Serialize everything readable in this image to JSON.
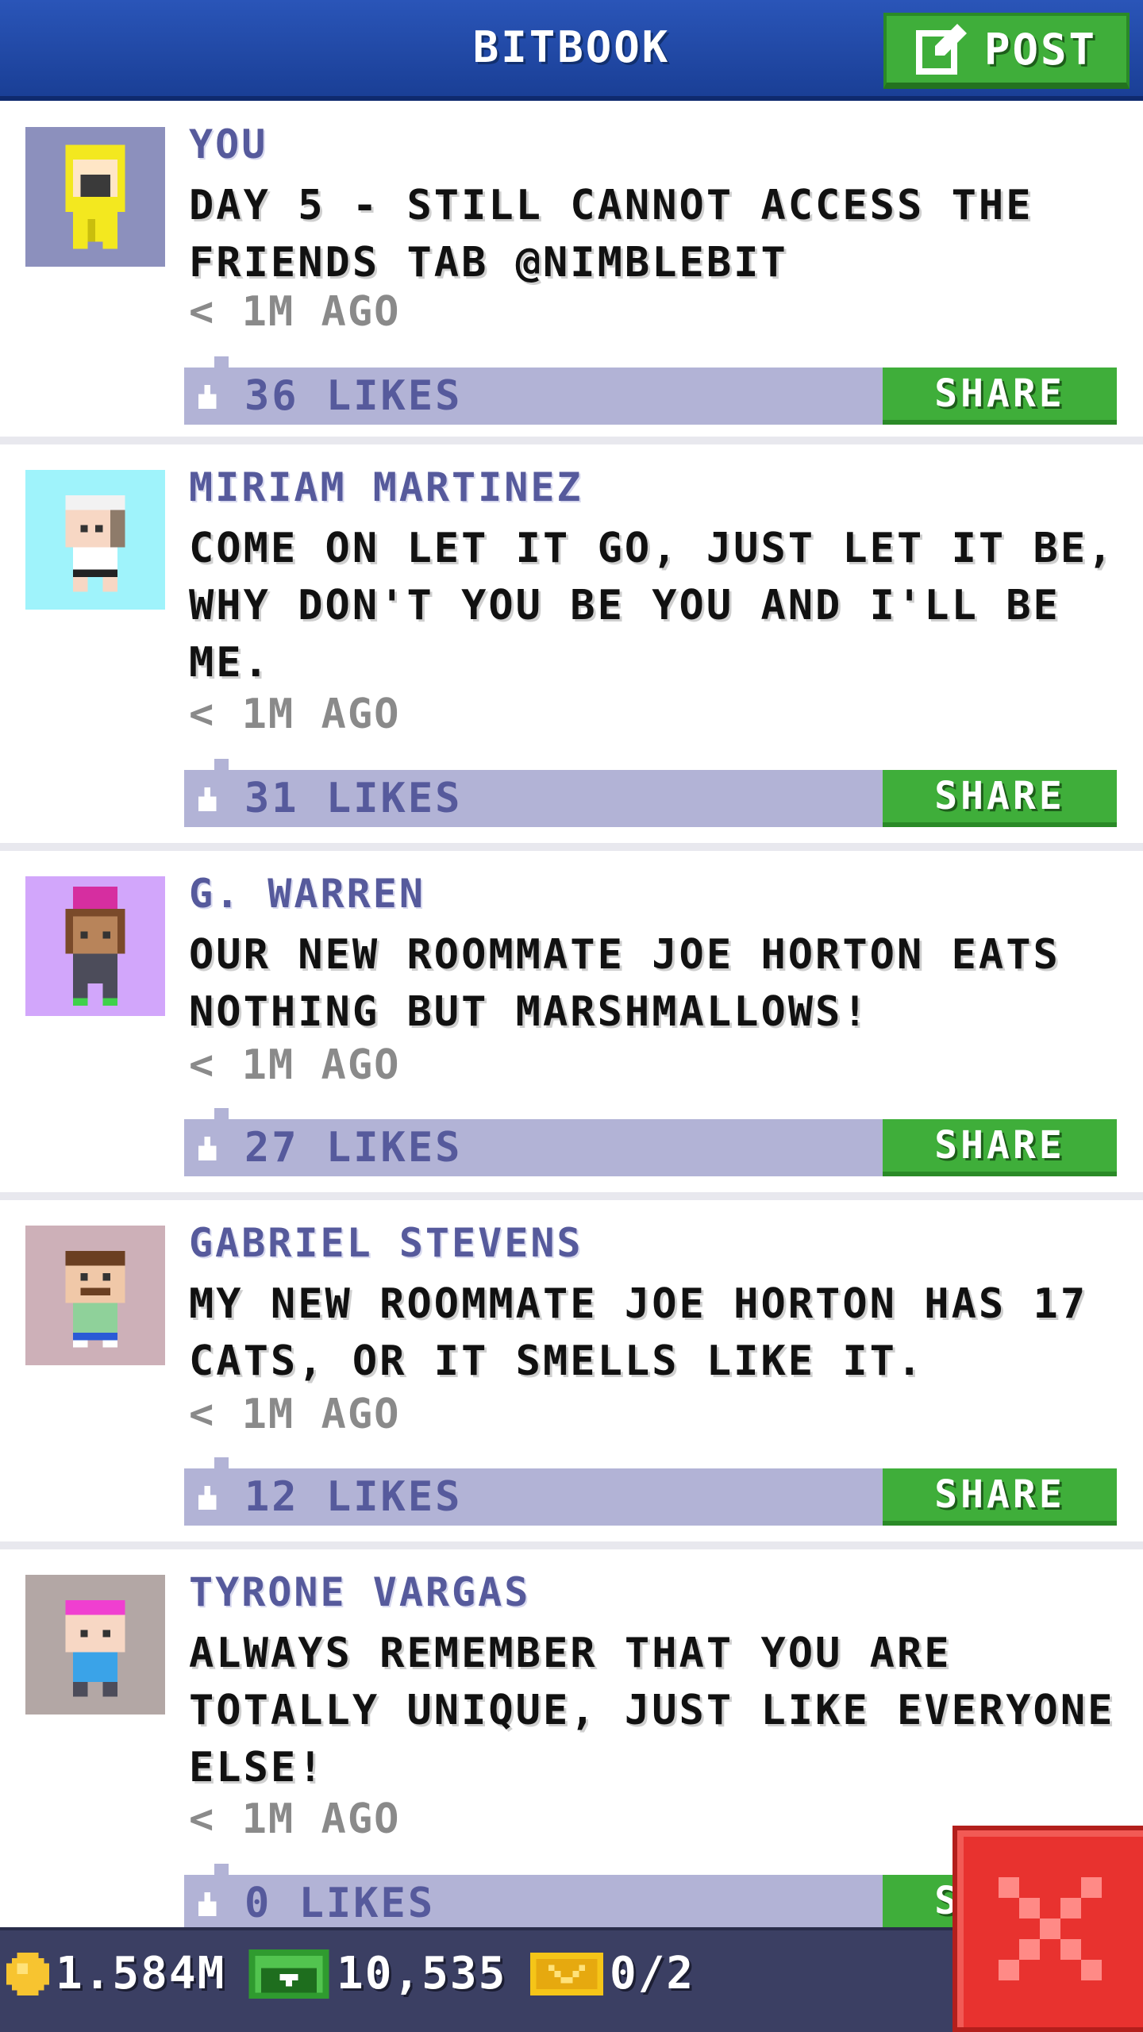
{
  "header": {
    "title": "BITBOOK",
    "post_label": "POST"
  },
  "posts": [
    {
      "author": "YOU",
      "message": "DAY 5 - STILL CANNOT ACCESS THE FRIENDS TAB @NIMBLEBIT",
      "time": "< 1M AGO",
      "likes": "36 LIKES",
      "share": "SHARE",
      "avatar_bg": "#8c90bd"
    },
    {
      "author": "MIRIAM MARTINEZ",
      "message": "COME ON LET IT GO, JUST LET IT BE, WHY DON'T YOU BE YOU AND I'LL BE ME.",
      "time": "< 1M AGO",
      "likes": "31 LIKES",
      "share": "SHARE",
      "avatar_bg": "#9ff3fb"
    },
    {
      "author": "G. WARREN",
      "message": "OUR NEW ROOMMATE JOE HORTON EATS NOTHING BUT MARSHMALLOWS!",
      "time": "< 1M AGO",
      "likes": "27 LIKES",
      "share": "SHARE",
      "avatar_bg": "#d2a6fb"
    },
    {
      "author": "GABRIEL STEVENS",
      "message": "MY NEW ROOMMATE JOE HORTON HAS 17 CATS, OR IT SMELLS LIKE IT.",
      "time": "< 1M AGO",
      "likes": "12 LIKES",
      "share": "SHARE",
      "avatar_bg": "#cdb0b8"
    },
    {
      "author": "TYRONE VARGAS",
      "message": "ALWAYS REMEMBER THAT YOU ARE TOTALLY UNIQUE, JUST LIKE EVERYONE ELSE!",
      "time": "< 1M AGO",
      "likes": "0 LIKES",
      "share": "SHARE",
      "avatar_bg": "#b3a7a5"
    }
  ],
  "bottom_bar": {
    "coins": "1.584M",
    "bux": "10,535",
    "tickets": "0/2"
  },
  "colors": {
    "accent_green": "#3fae3a",
    "header_blue": "#1f4aa8",
    "close_red": "#e8322f"
  },
  "icons": {
    "post": "edit-icon",
    "like": "thumbs-up-icon",
    "coin": "coin-icon",
    "bux": "bux-icon",
    "ticket": "ticket-icon",
    "close": "close-icon"
  }
}
